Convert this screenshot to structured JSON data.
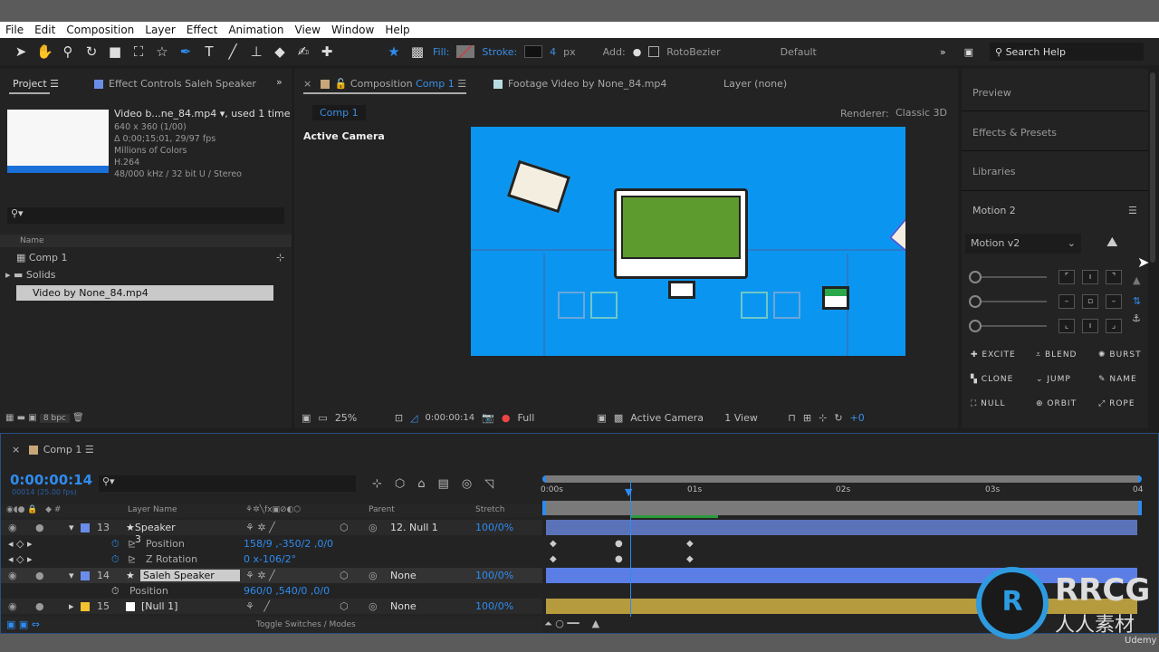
{
  "menu": [
    "File",
    "Edit",
    "Composition",
    "Layer",
    "Effect",
    "Animation",
    "View",
    "Window",
    "Help"
  ],
  "toolbar": {
    "fill_label": "Fill:",
    "stroke_label": "Stroke:",
    "stroke_width": "4",
    "stroke_unit": "px",
    "add_label": "Add:",
    "rotobezier_label": "RotoBezier",
    "workspace": "Default",
    "search_placeholder": "Search Help"
  },
  "project": {
    "tab": "Project",
    "effect_tab": "Effect Controls Saleh Speaker",
    "file_name": "Video b...ne_84.mp4",
    "used": ", used 1 time",
    "info": [
      "640 x 360 (1/00)",
      "Δ 0;00;15;01, 29/97 fps",
      "Millions of Colors",
      "H.264",
      "48/000 kHz / 32 bit U / Stereo"
    ],
    "col_name": "Name",
    "items": [
      "Comp 1",
      "Solids",
      "Video by None_84.mp4"
    ],
    "bpc": "8 bpc"
  },
  "viewer": {
    "tab_prefix": "Composition",
    "tab_comp": "Comp 1",
    "footage_tab": "Footage Video by None_84.mp4",
    "layer_tab": "Layer (none)",
    "comp_chip": "Comp 1",
    "renderer_label": "Renderer:",
    "renderer": "Classic 3D",
    "active_camera": "Active Camera",
    "zoom": "25%",
    "timecode": "0:00:00:14",
    "resolution": "Full",
    "camera": "Active Camera",
    "views": "1 View",
    "exposure": "+0",
    "bg_color": "#0a96f0"
  },
  "right": {
    "panels": [
      "Preview",
      "Effects & Presets",
      "Libraries",
      "Motion 2"
    ],
    "motion_select": "Motion v2",
    "buttons": [
      "EXCITE",
      "BLEND",
      "BURST",
      "CLONE",
      "JUMP",
      "NAME",
      "NULL",
      "ORBIT",
      "ROPE"
    ]
  },
  "timeline": {
    "tab": "Comp 1",
    "timecode": "0:00:00:14",
    "frame_info": "00014 (25.00 fps)",
    "col_layer": "Layer Name",
    "col_parent": "Parent",
    "col_stretch": "Stretch",
    "ruler": [
      "0:00s",
      "01s",
      "02s",
      "03s",
      "04"
    ],
    "toggle_label": "Toggle Switches / Modes",
    "layers": [
      {
        "num": "13",
        "name": "Speaker 3",
        "parent": "12. Null 1",
        "stretch": "100/0%",
        "color": "#6b8de8"
      },
      {
        "prop": "Position",
        "value": "158/9 ,-350/2 ,0/0"
      },
      {
        "prop": "Z Rotation",
        "value": "0 x-106/2°"
      },
      {
        "num": "14",
        "name": "Saleh Speaker",
        "parent": "None",
        "stretch": "100/0%",
        "color": "#6b8de8"
      },
      {
        "prop": "Position",
        "value": "960/0 ,540/0 ,0/0"
      },
      {
        "num": "15",
        "name": "[Null 1]",
        "parent": "None",
        "stretch": "100/0%",
        "color": "#f2c232"
      }
    ]
  },
  "watermark": {
    "brand": "RRCG",
    "sub": "人人素材",
    "udemy": "Udemy"
  }
}
